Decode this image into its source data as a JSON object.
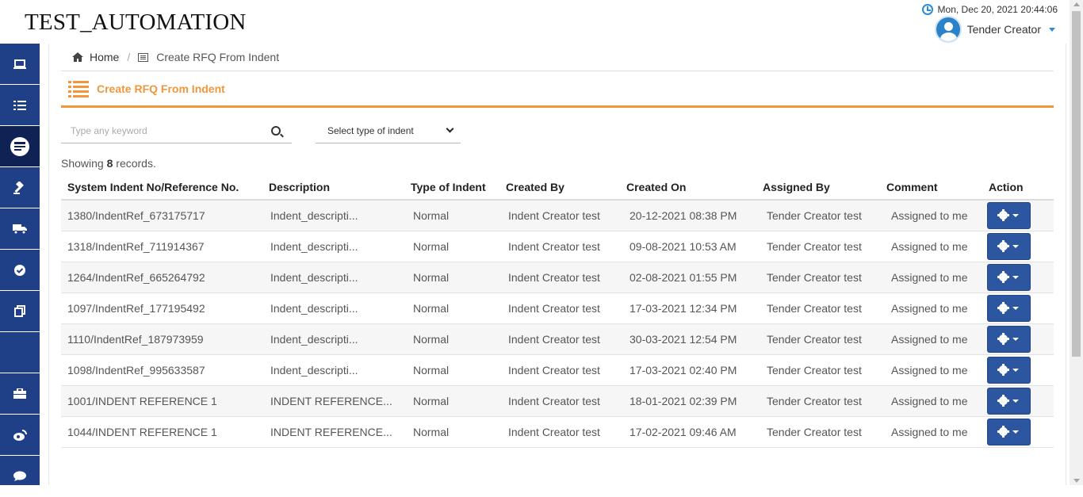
{
  "app": {
    "title": "TEST_AUTOMATION"
  },
  "header": {
    "datetime": "Mon, Dec 20, 2021 20:44:06",
    "user_name": "Tender Creator"
  },
  "sidebar": {
    "items": [
      {
        "icon": "laptop-icon",
        "glyph": "💻"
      },
      {
        "icon": "list-icon",
        "glyph": "☰"
      },
      {
        "icon": "tender-list-icon",
        "glyph": "≡"
      },
      {
        "icon": "gavel-icon",
        "glyph": "🔨"
      },
      {
        "icon": "truck-icon",
        "glyph": "🚚"
      },
      {
        "icon": "check-circle-icon",
        "glyph": "✔"
      },
      {
        "icon": "copy-icon",
        "glyph": "⧉"
      },
      {
        "icon": "briefcase-icon",
        "glyph": "💼"
      },
      {
        "icon": "weibo-icon",
        "glyph": "◉"
      },
      {
        "icon": "comments-icon",
        "glyph": "💬"
      }
    ]
  },
  "breadcrumb": {
    "home": "Home",
    "separator": "/",
    "current": "Create RFQ From Indent"
  },
  "section": {
    "title": "Create RFQ From Indent",
    "accent": "#f0963c"
  },
  "filters": {
    "search_placeholder": "Type any keyword",
    "select_value": "Select type of indent"
  },
  "records": {
    "prefix": "Showing",
    "count": "8",
    "suffix": "records."
  },
  "table": {
    "headers": [
      "System Indent No/Reference No.",
      "Description",
      "Type of Indent",
      "Created By",
      "Created On",
      "Assigned By",
      "Comment",
      "Action"
    ],
    "rows": [
      [
        "1380/IndentRef_673175717",
        "Indent_descripti...",
        "Normal",
        "Indent Creator test",
        "20-12-2021 08:38 PM",
        "Tender Creator test",
        "Assigned to me"
      ],
      [
        "1318/IndentRef_711914367",
        "Indent_descripti...",
        "Normal",
        "Indent Creator test",
        "09-08-2021 10:53 AM",
        "Tender Creator test",
        "Assigned to me"
      ],
      [
        "1264/IndentRef_665264792",
        "Indent_descripti...",
        "Normal",
        "Indent Creator test",
        "02-08-2021 01:55 PM",
        "Tender Creator test",
        "Assigned to me"
      ],
      [
        "1097/IndentRef_177195492",
        "Indent_descripti...",
        "Normal",
        "Indent Creator test",
        "17-03-2021 12:34 PM",
        "Tender Creator test",
        "Assigned to me"
      ],
      [
        "1110/IndentRef_187973959",
        "Indent_descripti...",
        "Normal",
        "Indent Creator test",
        "30-03-2021 12:54 PM",
        "Tender Creator test",
        "Assigned to me"
      ],
      [
        "1098/IndentRef_995633587",
        "Indent_descripti...",
        "Normal",
        "Indent Creator test",
        "17-03-2021 02:40 PM",
        "Tender Creator test",
        "Assigned to me"
      ],
      [
        "1001/INDENT REFERENCE 1",
        "INDENT REFERENCE...",
        "Normal",
        "Indent Creator test",
        "18-01-2021 02:39 PM",
        "Tender Creator test",
        "Assigned to me"
      ],
      [
        "1044/INDENT REFERENCE 1",
        "INDENT REFERENCE...",
        "Normal",
        "Indent Creator test",
        "17-02-2021 09:46 AM",
        "Tender Creator test",
        "Assigned to me"
      ]
    ]
  },
  "colors": {
    "sidebar_bg": "#1f3f86",
    "action_btn": "#2d56a0",
    "accent": "#f0963c"
  }
}
